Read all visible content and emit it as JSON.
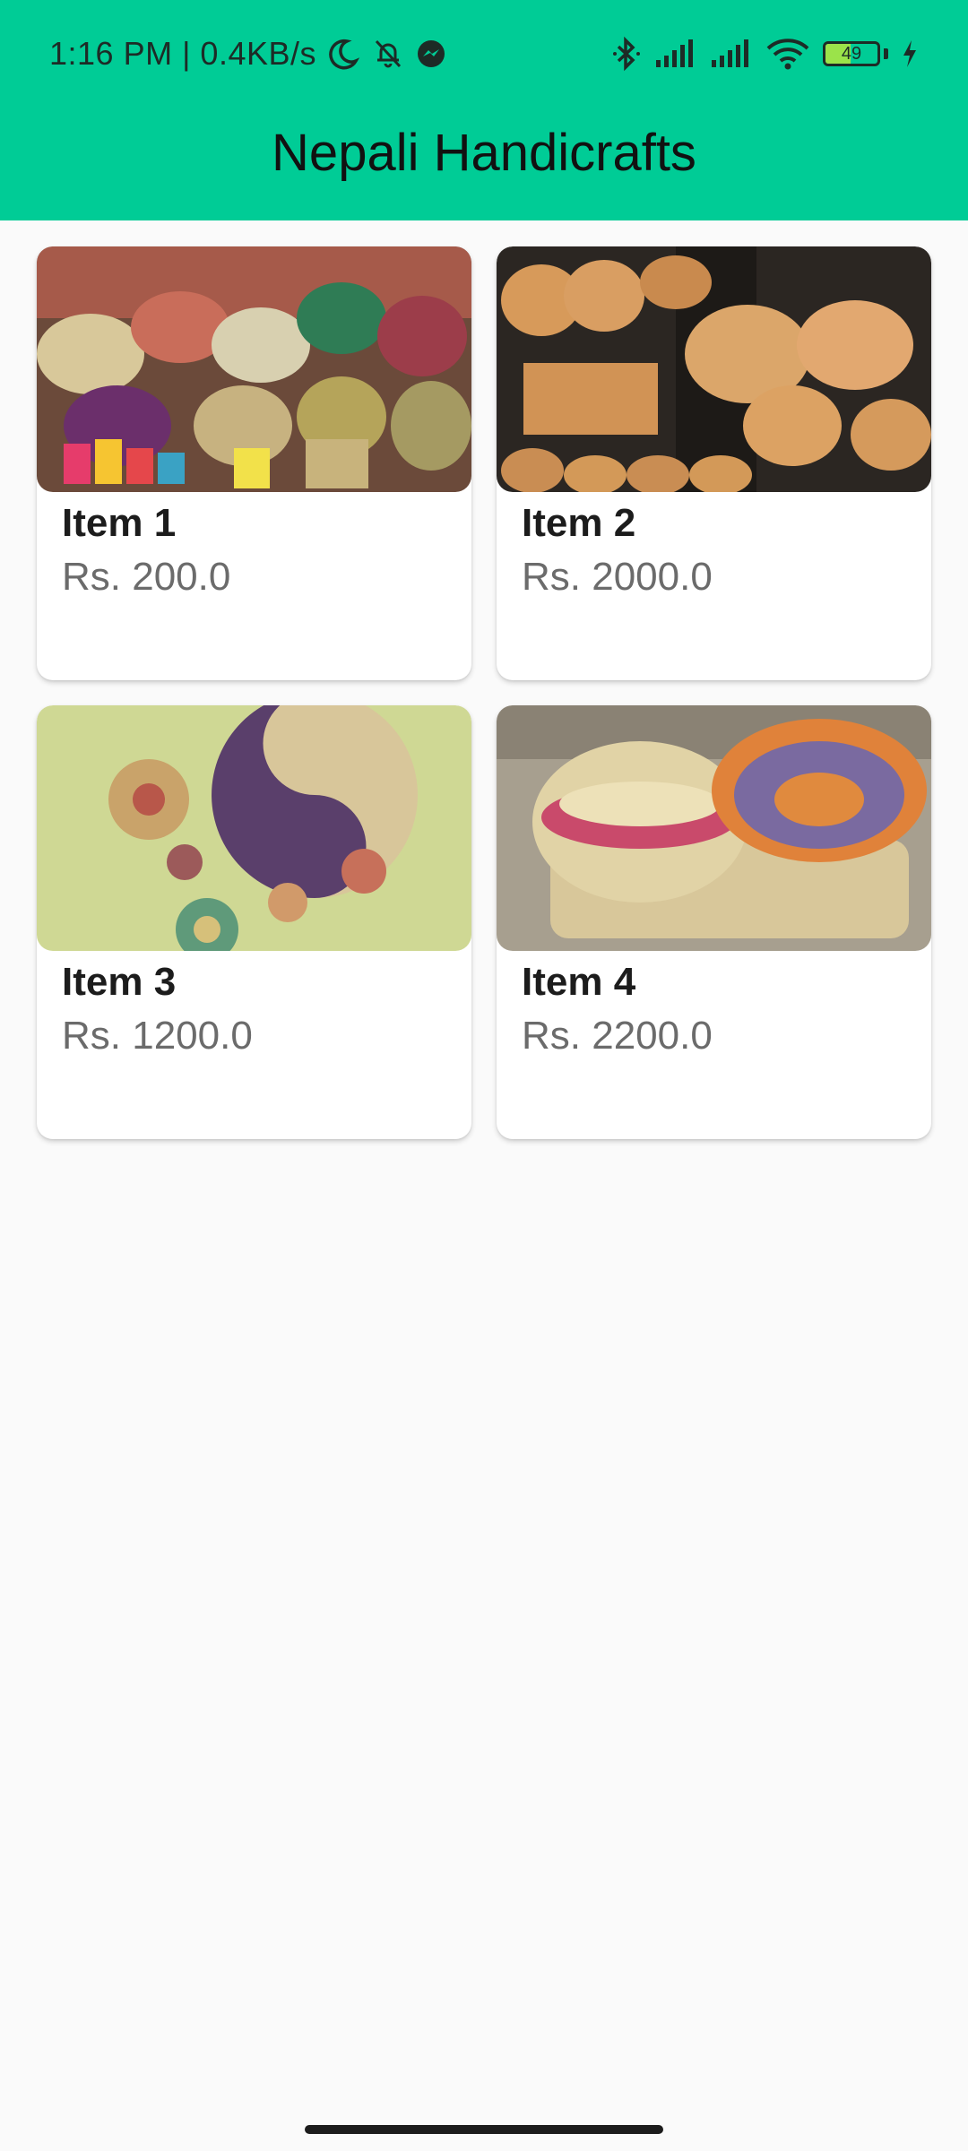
{
  "status_bar": {
    "time_net": "1:16 PM | 0.4KB/s",
    "icons": [
      "moon-icon",
      "bell-off-icon",
      "messenger-icon",
      "bluetooth-icon",
      "signal-icon",
      "signal-icon",
      "wifi-icon",
      "battery-icon",
      "charging-icon"
    ],
    "battery_level": "49",
    "battery_fraction": 0.49
  },
  "app_bar": {
    "title": "Nepali Handicrafts",
    "color": "#00cc96"
  },
  "items": [
    {
      "title": "Item 1",
      "price": "Rs. 200.0",
      "image": "woven-baskets-photo"
    },
    {
      "title": "Item 2",
      "price": "Rs. 2000.0",
      "image": "straw-containers-photo"
    },
    {
      "title": "Item 3",
      "price": "Rs. 1200.0",
      "image": "wall-plates-photo"
    },
    {
      "title": "Item 4",
      "price": "Rs. 2200.0",
      "image": "woven-bowls-photo"
    }
  ]
}
